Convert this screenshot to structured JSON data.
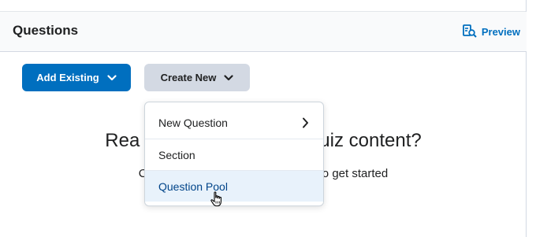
{
  "header": {
    "title": "Questions",
    "preview_label": "Preview"
  },
  "toolbar": {
    "add_existing_label": "Add Existing",
    "create_new_label": "Create New"
  },
  "empty_state": {
    "title_visible_left": "Rea",
    "title_visible_right": "uiz content?",
    "subtitle_visible_left": "C",
    "subtitle_visible_right": "to get started"
  },
  "create_menu": {
    "items": [
      {
        "label": "New Question",
        "has_submenu": true
      },
      {
        "label": "Section",
        "has_submenu": false
      },
      {
        "label": "Question Pool",
        "has_submenu": false,
        "hovered": true
      }
    ]
  },
  "icons": {
    "preview": "preview-magnifier-icon",
    "dropdown": "chevron-down-icon",
    "submenu": "chevron-right-icon",
    "cursor": "hand-pointer-icon"
  },
  "colors": {
    "primary": "#006fbf",
    "secondary_button": "#d3d9e3",
    "hover_bg": "#e8f2fb",
    "text": "#202122"
  }
}
